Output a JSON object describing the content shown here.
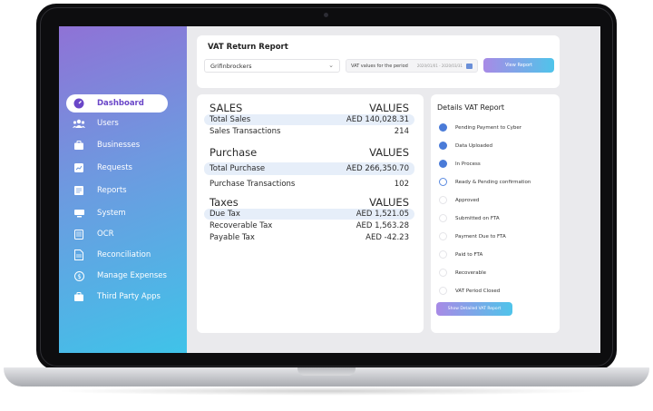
{
  "sidebar": {
    "items": [
      {
        "label": "Dashboard",
        "icon": "gauge-icon",
        "active": true
      },
      {
        "label": "Users",
        "icon": "users-icon"
      },
      {
        "label": "Businesses",
        "icon": "briefcase-icon"
      },
      {
        "label": "Requests",
        "icon": "chart-icon"
      },
      {
        "label": "Reports",
        "icon": "document-icon"
      },
      {
        "label": "System",
        "icon": "system-icon"
      },
      {
        "label": "OCR",
        "icon": "ocr-icon"
      },
      {
        "label": "Reconciliation",
        "icon": "file-icon"
      },
      {
        "label": "Manage Expenses",
        "icon": "dollar-icon"
      },
      {
        "label": "Third Party Apps",
        "icon": "apps-icon"
      }
    ]
  },
  "report": {
    "title": "VAT Return Report",
    "company": "Grifinbrockers",
    "period_label": "VAT values for the period",
    "period_value": "2020/01/01 - 2020/03/31",
    "view_button": "View Report"
  },
  "values": {
    "sales_header": "SALES",
    "sales_values_header": "VALUES",
    "sales_rows": [
      {
        "label": "Total Sales",
        "value": "AED 140,028.31"
      },
      {
        "label": "Sales Transactions",
        "value": "214"
      }
    ],
    "purchase_header": "Purchase",
    "purchase_values_header": "VALUES",
    "purchase_rows": [
      {
        "label": "Total Purchase",
        "value": "AED 266,350.70"
      },
      {
        "label": "Purchase Transactions",
        "value": "102"
      }
    ],
    "taxes_header": "Taxes",
    "taxes_values_header": "VALUES",
    "taxes_rows": [
      {
        "label": "Due Tax",
        "value": "AED 1,521.05"
      },
      {
        "label": "Recoverable Tax",
        "value": "AED 1,563.28"
      },
      {
        "label": "Payable Tax",
        "value": "AED -42.23"
      }
    ]
  },
  "details": {
    "title": "Details VAT Report",
    "steps": [
      {
        "label": "Pending Payment to Cyber",
        "state": "done"
      },
      {
        "label": "Data Uploaded",
        "state": "done"
      },
      {
        "label": "In Process",
        "state": "done"
      },
      {
        "label": "Ready & Pending confirmation",
        "state": "progress"
      },
      {
        "label": "Approved",
        "state": "todo"
      },
      {
        "label": "Submitted on FTA",
        "state": "todo"
      },
      {
        "label": "Payment Due to FTA",
        "state": "todo"
      },
      {
        "label": "Paid to FTA",
        "state": "todo"
      },
      {
        "label": "Recoverable",
        "state": "todo"
      },
      {
        "label": "VAT Period Closed",
        "state": "todo"
      }
    ],
    "button": "Show Detailed VAT Report"
  },
  "colors": {
    "accent": "#6a46c8",
    "check": "#4a7bd8",
    "highlight": "#e6eef9"
  }
}
